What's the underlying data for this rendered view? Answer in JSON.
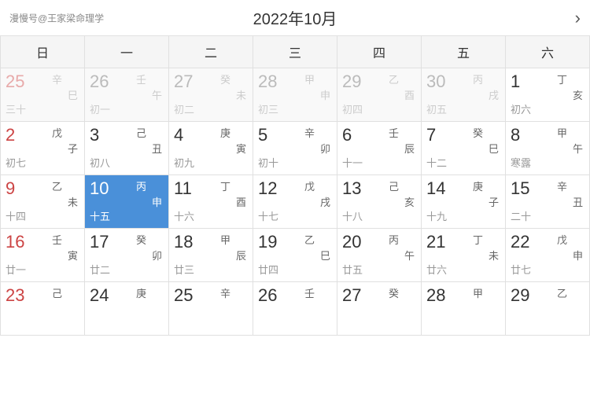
{
  "header": {
    "logo": "漫慢号@王家梁命理学",
    "title": "2022年10月",
    "nav_right": "›"
  },
  "weekdays": [
    "日",
    "一",
    "二",
    "三",
    "四",
    "五",
    "六"
  ],
  "weeks": [
    [
      {
        "day": "25",
        "heavenly": "辛",
        "earthly": "巳",
        "lunar": "三十",
        "solar_term": "",
        "outside": true,
        "sunday": true,
        "selected": false
      },
      {
        "day": "26",
        "heavenly": "壬",
        "earthly": "午",
        "lunar": "初一",
        "solar_term": "",
        "outside": true,
        "sunday": false,
        "selected": false
      },
      {
        "day": "27",
        "heavenly": "癸",
        "earthly": "未",
        "lunar": "初二",
        "solar_term": "",
        "outside": true,
        "sunday": false,
        "selected": false
      },
      {
        "day": "28",
        "heavenly": "甲",
        "earthly": "申",
        "lunar": "初三",
        "solar_term": "",
        "outside": true,
        "sunday": false,
        "selected": false
      },
      {
        "day": "29",
        "heavenly": "乙",
        "earthly": "酉",
        "lunar": "初四",
        "solar_term": "",
        "outside": true,
        "sunday": false,
        "selected": false
      },
      {
        "day": "30",
        "heavenly": "丙",
        "earthly": "戌",
        "lunar": "初五",
        "solar_term": "",
        "outside": true,
        "sunday": false,
        "selected": false
      },
      {
        "day": "1",
        "heavenly": "丁",
        "earthly": "亥",
        "lunar": "初六",
        "solar_term": "",
        "outside": false,
        "sunday": false,
        "selected": false
      }
    ],
    [
      {
        "day": "2",
        "heavenly": "戊",
        "earthly": "子",
        "lunar": "初七",
        "solar_term": "",
        "outside": false,
        "sunday": true,
        "selected": false
      },
      {
        "day": "3",
        "heavenly": "己",
        "earthly": "丑",
        "lunar": "初八",
        "solar_term": "",
        "outside": false,
        "sunday": false,
        "selected": false
      },
      {
        "day": "4",
        "heavenly": "庚",
        "earthly": "寅",
        "lunar": "初九",
        "solar_term": "",
        "outside": false,
        "sunday": false,
        "selected": false
      },
      {
        "day": "5",
        "heavenly": "辛",
        "earthly": "卯",
        "lunar": "初十",
        "solar_term": "",
        "outside": false,
        "sunday": false,
        "selected": false
      },
      {
        "day": "6",
        "heavenly": "壬",
        "earthly": "辰",
        "lunar": "十一",
        "solar_term": "",
        "outside": false,
        "sunday": false,
        "selected": false
      },
      {
        "day": "7",
        "heavenly": "癸",
        "earthly": "巳",
        "lunar": "十二",
        "solar_term": "",
        "outside": false,
        "sunday": false,
        "selected": false
      },
      {
        "day": "8",
        "heavenly": "甲",
        "earthly": "午",
        "lunar": "寒露",
        "solar_term": "",
        "outside": false,
        "sunday": false,
        "selected": false
      }
    ],
    [
      {
        "day": "9",
        "heavenly": "乙",
        "earthly": "未",
        "lunar": "十四",
        "solar_term": "",
        "outside": false,
        "sunday": true,
        "selected": false
      },
      {
        "day": "10",
        "heavenly": "丙",
        "earthly": "申",
        "lunar": "十五",
        "solar_term": "",
        "outside": false,
        "sunday": false,
        "selected": true
      },
      {
        "day": "11",
        "heavenly": "丁",
        "earthly": "酉",
        "lunar": "十六",
        "solar_term": "",
        "outside": false,
        "sunday": false,
        "selected": false
      },
      {
        "day": "12",
        "heavenly": "戊",
        "earthly": "戌",
        "lunar": "十七",
        "solar_term": "",
        "outside": false,
        "sunday": false,
        "selected": false
      },
      {
        "day": "13",
        "heavenly": "己",
        "earthly": "亥",
        "lunar": "十八",
        "solar_term": "",
        "outside": false,
        "sunday": false,
        "selected": false
      },
      {
        "day": "14",
        "heavenly": "庚",
        "earthly": "子",
        "lunar": "十九",
        "solar_term": "",
        "outside": false,
        "sunday": false,
        "selected": false
      },
      {
        "day": "15",
        "heavenly": "辛",
        "earthly": "丑",
        "lunar": "二十",
        "solar_term": "",
        "outside": false,
        "sunday": false,
        "selected": false
      }
    ],
    [
      {
        "day": "16",
        "heavenly": "壬",
        "earthly": "寅",
        "lunar": "廿一",
        "solar_term": "",
        "outside": false,
        "sunday": true,
        "selected": false
      },
      {
        "day": "17",
        "heavenly": "癸",
        "earthly": "卯",
        "lunar": "廿二",
        "solar_term": "",
        "outside": false,
        "sunday": false,
        "selected": false
      },
      {
        "day": "18",
        "heavenly": "甲",
        "earthly": "辰",
        "lunar": "廿三",
        "solar_term": "",
        "outside": false,
        "sunday": false,
        "selected": false
      },
      {
        "day": "19",
        "heavenly": "乙",
        "earthly": "巳",
        "lunar": "廿四",
        "solar_term": "",
        "outside": false,
        "sunday": false,
        "selected": false
      },
      {
        "day": "20",
        "heavenly": "丙",
        "earthly": "午",
        "lunar": "廿五",
        "solar_term": "",
        "outside": false,
        "sunday": false,
        "selected": false
      },
      {
        "day": "21",
        "heavenly": "丁",
        "earthly": "未",
        "lunar": "廿六",
        "solar_term": "",
        "outside": false,
        "sunday": false,
        "selected": false
      },
      {
        "day": "22",
        "heavenly": "戊",
        "earthly": "申",
        "lunar": "廿七",
        "solar_term": "",
        "outside": false,
        "sunday": false,
        "selected": false
      }
    ],
    [
      {
        "day": "23",
        "heavenly": "己",
        "earthly": "",
        "lunar": "",
        "solar_term": "",
        "outside": false,
        "sunday": true,
        "selected": false
      },
      {
        "day": "24",
        "heavenly": "庚",
        "earthly": "",
        "lunar": "",
        "solar_term": "",
        "outside": false,
        "sunday": false,
        "selected": false
      },
      {
        "day": "25",
        "heavenly": "辛",
        "earthly": "",
        "lunar": "",
        "solar_term": "",
        "outside": false,
        "sunday": false,
        "selected": false
      },
      {
        "day": "26",
        "heavenly": "壬",
        "earthly": "",
        "lunar": "",
        "solar_term": "",
        "outside": false,
        "sunday": false,
        "selected": false
      },
      {
        "day": "27",
        "heavenly": "癸",
        "earthly": "",
        "lunar": "",
        "solar_term": "",
        "outside": false,
        "sunday": false,
        "selected": false
      },
      {
        "day": "28",
        "heavenly": "甲",
        "earthly": "",
        "lunar": "",
        "solar_term": "",
        "outside": false,
        "sunday": false,
        "selected": false
      },
      {
        "day": "29",
        "heavenly": "乙",
        "earthly": "",
        "lunar": "",
        "solar_term": "",
        "outside": false,
        "sunday": false,
        "selected": false
      }
    ]
  ]
}
